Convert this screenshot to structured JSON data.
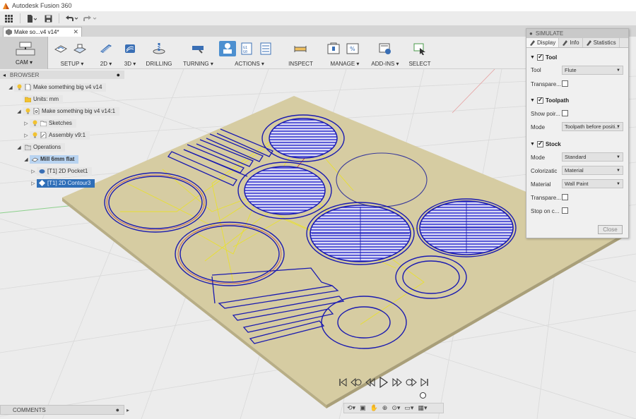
{
  "app": {
    "title": "Autodesk Fusion 360"
  },
  "document_tab": {
    "label": "Make so...v4 v14*"
  },
  "workspace": {
    "label": "CAM ▾"
  },
  "toolbar": {
    "setup": "SETUP ▾",
    "two_d": "2D ▾",
    "three_d": "3D ▾",
    "drilling": "DRILLING",
    "turning": "TURNING ▾",
    "actions": "ACTIONS ▾",
    "inspect": "INSPECT",
    "manage": "MANAGE ▾",
    "addins": "ADD-INS ▾",
    "select": "SELECT"
  },
  "browser": {
    "title": "BROWSER",
    "items": [
      {
        "label": "Make something big v4 v14"
      },
      {
        "label": "Units: mm"
      },
      {
        "label": "Make something big v4 v14:1"
      },
      {
        "label": "Sketches"
      },
      {
        "label": "Assembly v9:1"
      },
      {
        "label": "Operations"
      },
      {
        "label": "Mill 6mm flat"
      },
      {
        "label": "[T1] 2D Pocket1"
      },
      {
        "label": "[T1] 2D Contour3"
      }
    ]
  },
  "simulate": {
    "title": "SIMULATE",
    "tabs": [
      "Display",
      "Info",
      "Statistics"
    ],
    "tool_section": "Tool",
    "tool_label": "Tool",
    "tool_value": "Flute",
    "transparent_label": "Transpare...",
    "toolpath_section": "Toolpath",
    "show_points_label": "Show poir...",
    "mode_label": "Mode",
    "toolpath_mode_value": "Toolpath before positi...",
    "stock_section": "Stock",
    "stock_mode_value": "Standard",
    "colorization_label": "Colorizatic",
    "colorization_value": "Material",
    "material_label": "Material",
    "material_value": "Wall Paint",
    "stock_transparent_label": "Transpare...",
    "stop_on_collision_label": "Stop on c...",
    "close_button": "Close"
  },
  "comments": {
    "label": "COMMENTS"
  },
  "colors": {
    "stock": "#d6cca2",
    "toolpath": "#2020c0",
    "rapid": "#e8e030",
    "selected": "#2f6fb8"
  }
}
